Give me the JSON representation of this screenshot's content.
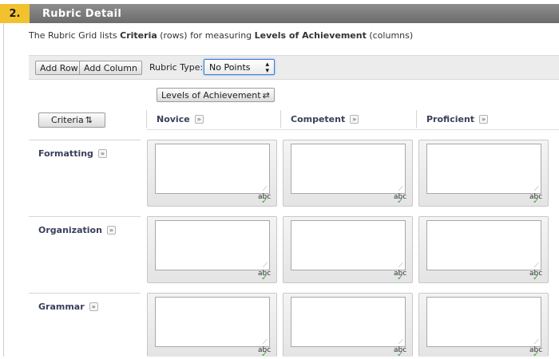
{
  "section": {
    "number": "2.",
    "title": "Rubric Detail"
  },
  "description": {
    "part1": "The Rubric Grid lists ",
    "criteria": "Criteria",
    "part2": " (rows) for measuring ",
    "levels": "Levels of Achievement",
    "part3": " (columns)"
  },
  "toolbar": {
    "add_row": "Add Row",
    "add_column": "Add Column",
    "rubric_type_label": "Rubric Type:",
    "rubric_type_value": "No Points"
  },
  "levels_button": "Levels of Achievement",
  "criteria_button": "Criteria",
  "columns": [
    "Novice",
    "Competent",
    "Proficient"
  ],
  "rows": [
    "Formatting",
    "Organization",
    "Grammar"
  ],
  "spellcheck_label": "abc",
  "colors": {
    "step_badge": "#f2c12e",
    "title_bar": "#7a7a7a",
    "select_focus": "#3b7fd6",
    "heading_text": "#3a3f5a"
  }
}
